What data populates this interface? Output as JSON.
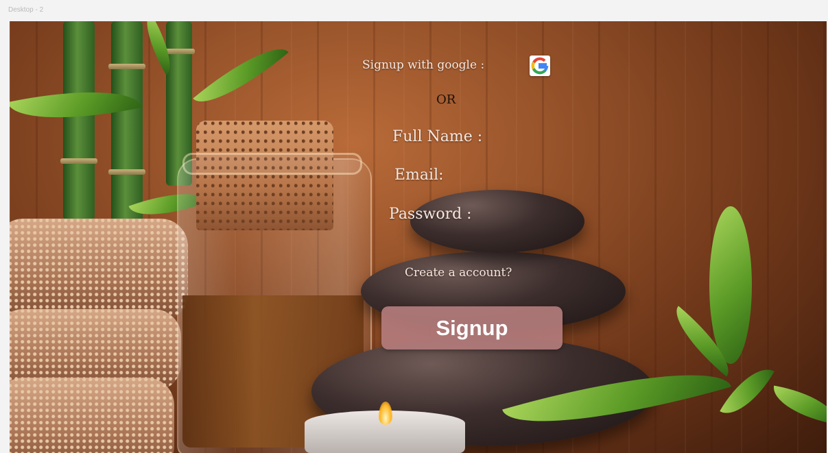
{
  "frame": {
    "label": "Desktop - 2"
  },
  "signup_form": {
    "google_label": "Signup with google :",
    "google_icon": "google-logo",
    "or_label": "OR",
    "full_name_label": "Full Name :",
    "full_name_value": "",
    "email_label": "Email:",
    "email_value": "",
    "password_label": "Password  :",
    "password_value": "",
    "create_account_link": "Create a account?",
    "signup_button_label": "Signup"
  },
  "colors": {
    "signup_button": "#b37b7b",
    "label_text": "#f4e9e2",
    "or_text": "#1d0f08"
  }
}
